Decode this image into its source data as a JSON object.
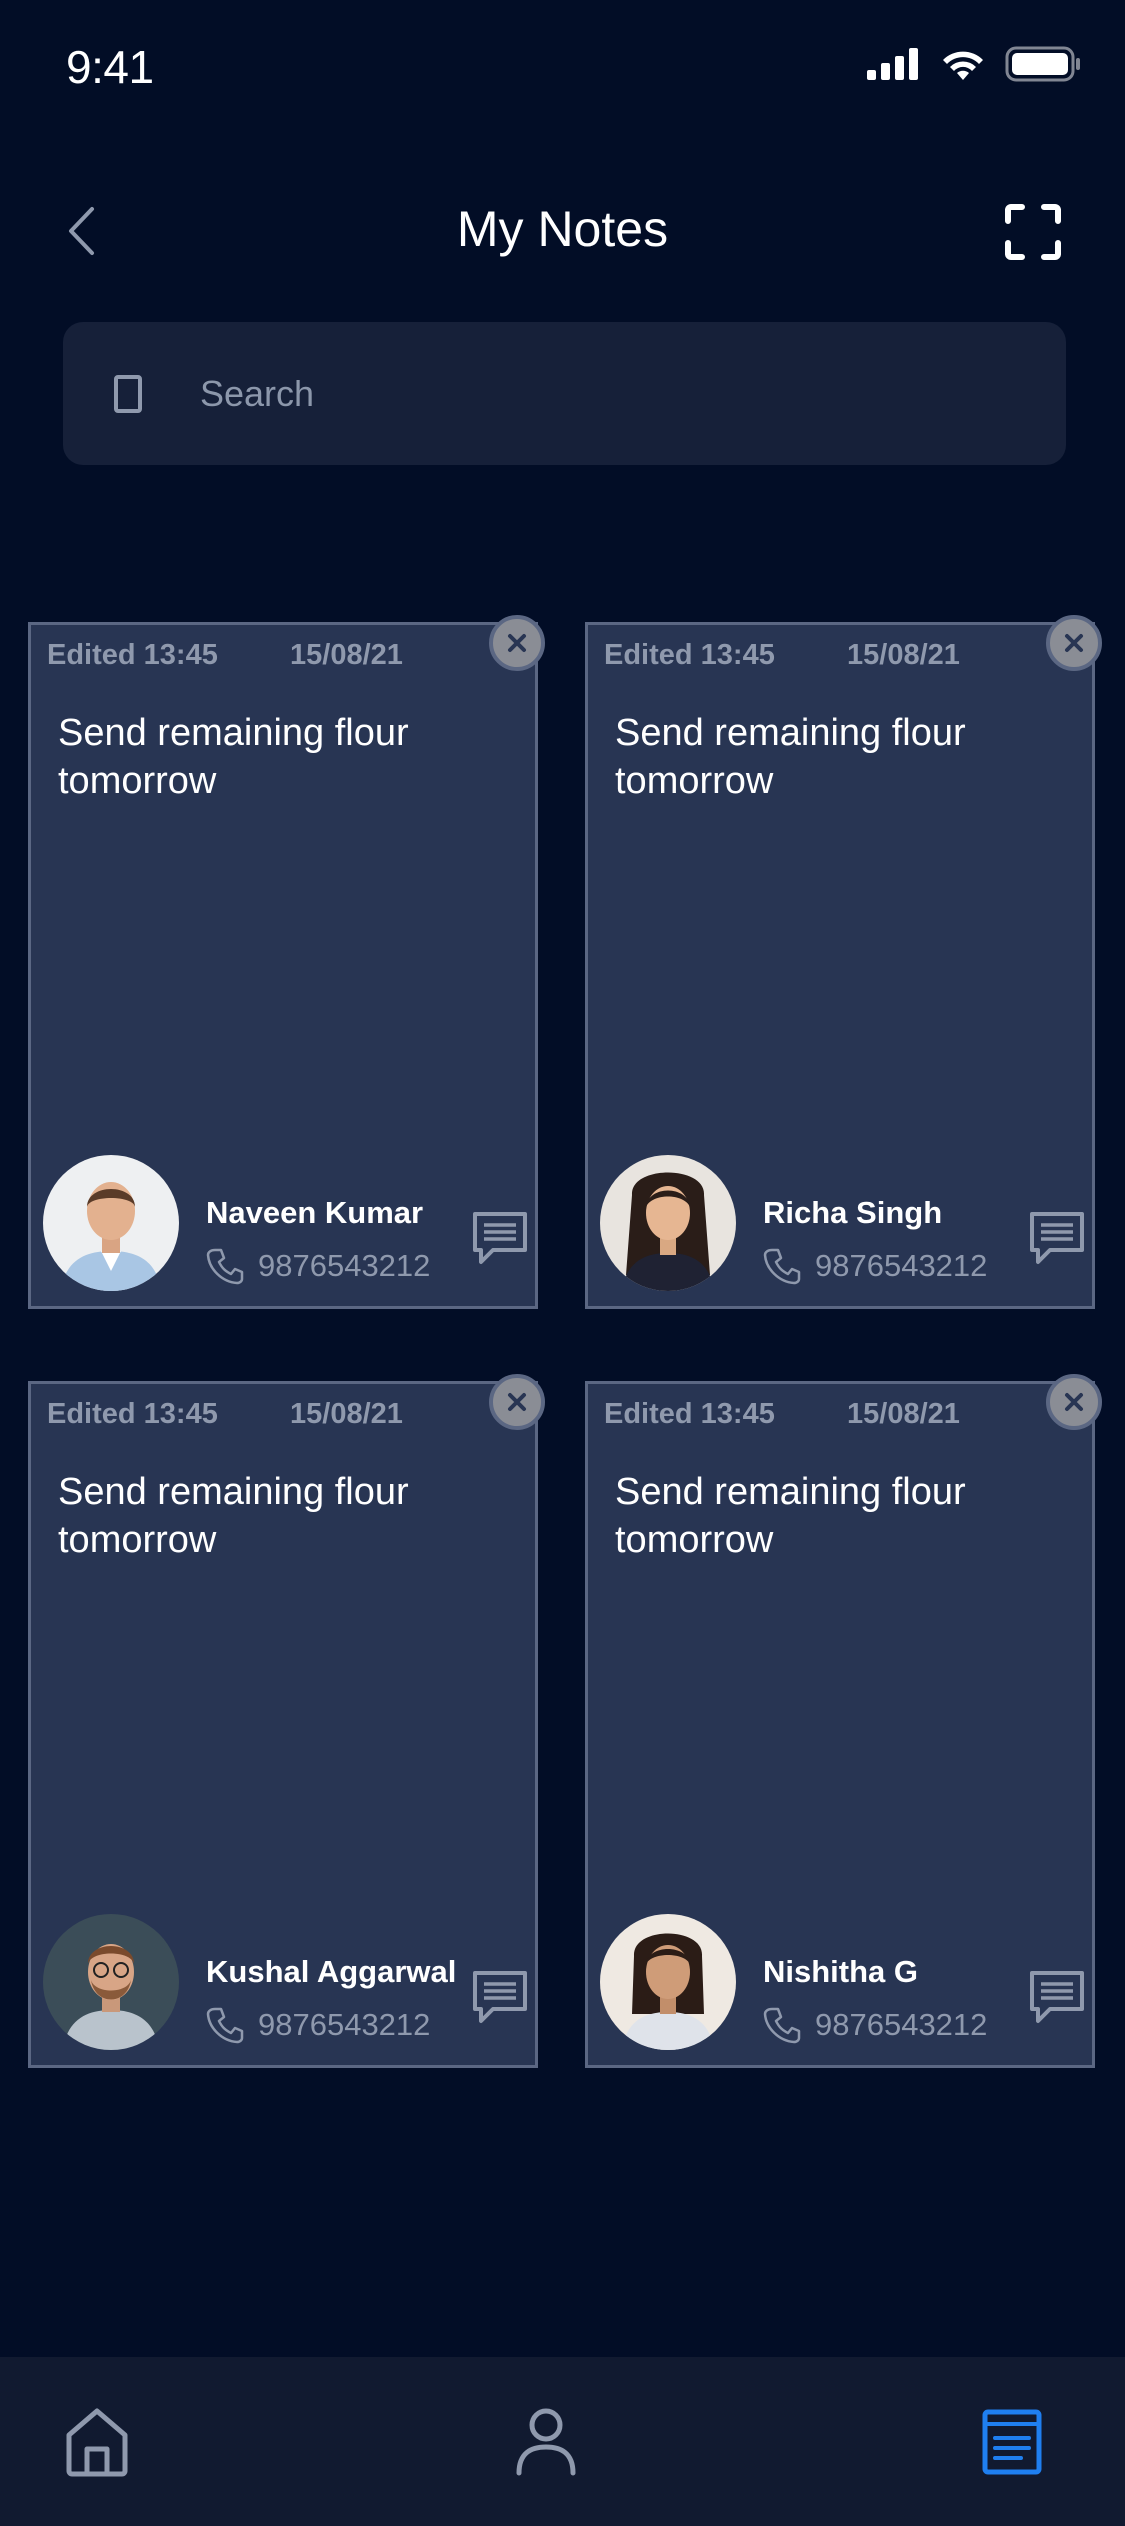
{
  "status": {
    "time": "9:41"
  },
  "header": {
    "title": "My Notes"
  },
  "search": {
    "placeholder": "Search"
  },
  "notes": [
    {
      "edited": "Edited 13:45",
      "date": "15/08/21",
      "text": "Send remaining flour tomorrow",
      "name": "Naveen Kumar",
      "phone": "9876543212"
    },
    {
      "edited": "Edited 13:45",
      "date": "15/08/21",
      "text": "Send remaining flour tomorrow",
      "name": "Richa Singh",
      "phone": "9876543212"
    },
    {
      "edited": "Edited 13:45",
      "date": "15/08/21",
      "text": "Send remaining flour tomorrow",
      "name": "Kushal Aggarwal",
      "phone": "9876543212"
    },
    {
      "edited": "Edited 13:45",
      "date": "15/08/21",
      "text": "Send remaining flour tomorrow",
      "name": "Nishitha G",
      "phone": "9876543212"
    }
  ],
  "nav": {
    "items": [
      "home-icon",
      "profile-icon",
      "notes-icon"
    ],
    "active": "notes-icon"
  },
  "colors": {
    "background": "#020d26",
    "card": "#283553",
    "accent": "#1f7ff0",
    "muted": "#8f99ad"
  }
}
